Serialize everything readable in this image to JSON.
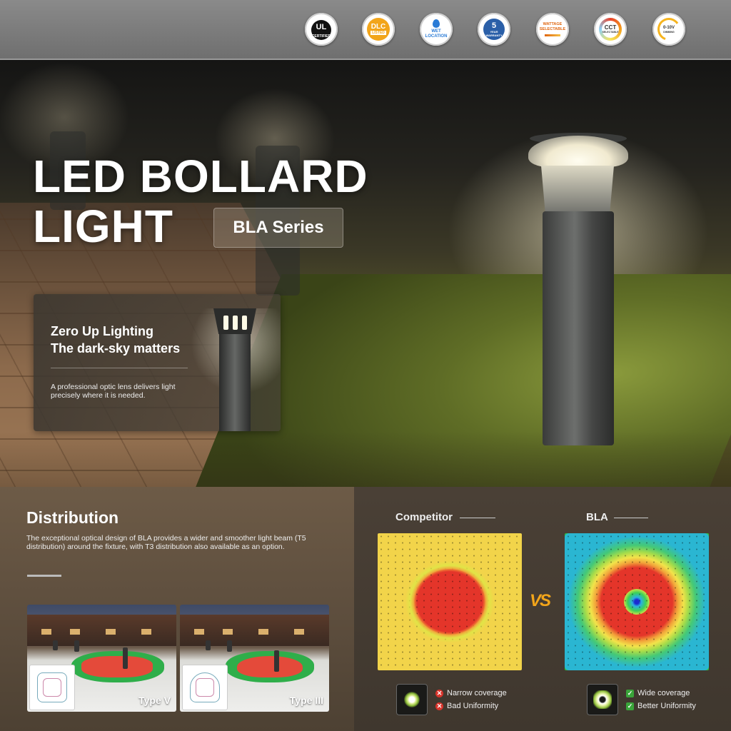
{
  "badges": {
    "ul": {
      "mark": "UL",
      "text": "CERTIFIED"
    },
    "dlc": {
      "big": "DLC",
      "small": "LISTED"
    },
    "wet": {
      "line1": "WET",
      "line2": "LOCATION"
    },
    "warranty": {
      "number": "5",
      "text": "YEAR WARRANTY"
    },
    "wattage": {
      "line1": "WATTAGE",
      "line2": "SELECTABLE"
    },
    "cct": {
      "big": "CCT",
      "small": "SELECTABLE"
    },
    "dimming": {
      "big": "0-10V",
      "small": "DIMMING"
    }
  },
  "hero": {
    "title_line1": "LED BOLLARD",
    "title_line2": "LIGHT",
    "series": "BLA Series"
  },
  "card": {
    "heading_line1": "Zero Up Lighting",
    "heading_line2": "The dark-sky matters",
    "body": "A professional optic lens delivers light precisely where it is needed."
  },
  "distribution": {
    "title": "Distribution",
    "description": "The exceptional optical design of BLA provides a wider and smoother light beam (T5 distribution) around the fixture, with T3 distribution also available as an option.",
    "types": [
      {
        "label": "Type V"
      },
      {
        "label": "Type III"
      }
    ]
  },
  "comparison": {
    "competitor_label": "Competitor",
    "bla_label": "BLA",
    "vs": "VS",
    "competitor_features": [
      "Narrow coverage",
      "Bad Uniformity"
    ],
    "bla_features": [
      "Wide coverage",
      "Better Uniformity"
    ]
  },
  "colors": {
    "accent_orange": "#f2a51a",
    "bad_red": "#d8342b",
    "good_green": "#3aa53a"
  }
}
